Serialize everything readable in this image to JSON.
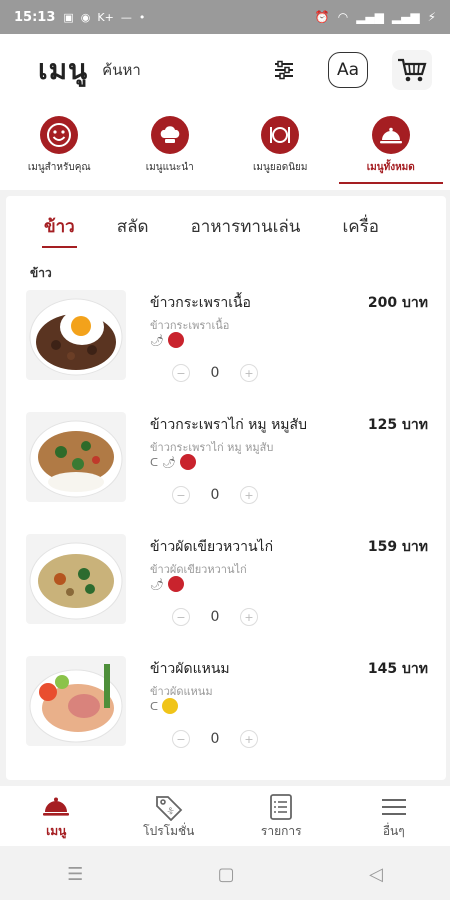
{
  "status": {
    "time": "15:13",
    "icons_left": [
      "LINE",
      "msg",
      "K+",
      "—",
      "•"
    ],
    "icons_right": [
      "alarm",
      "wifi",
      "signal",
      "signal",
      "charging"
    ]
  },
  "header": {
    "title": "เมนู",
    "search_label": "ค้นหา",
    "font_button": "Aa"
  },
  "categories": [
    {
      "label": "เมนูสำหรับคุณ",
      "icon": "smile-icon"
    },
    {
      "label": "เมนูแนะนำ",
      "icon": "chef-hat-icon"
    },
    {
      "label": "เมนูยอดนิยม",
      "icon": "plate-icon"
    },
    {
      "label": "เมนูทั้งหมด",
      "icon": "cloche-icon",
      "active": true
    }
  ],
  "subtabs": [
    "ข้าว",
    "สลัด",
    "อาหารทานเล่น",
    "เครื่อ"
  ],
  "section_title": "ข้าว",
  "items": [
    {
      "name": "ข้าวกระเพราเนื้อ",
      "desc": "ข้าวกระเพราเนื้อ",
      "price": "200 บาท",
      "qty": "0",
      "tags": [
        "🌶"
      ],
      "dots": [
        "#c9232d"
      ]
    },
    {
      "name": "ข้าวกระเพราไก่ หมู หมูสับ",
      "desc": "ข้าวกระเพราไก่ หมู หมูสับ",
      "price": "125 บาท",
      "qty": "0",
      "tags": [
        "ᑕ",
        "🌶"
      ],
      "dots": [
        "#c9232d"
      ]
    },
    {
      "name": "ข้าวผัดเขียวหวานไก่",
      "desc": "ข้าวผัดเขียวหวานไก่",
      "price": "159 บาท",
      "qty": "0",
      "tags": [
        "🌶"
      ],
      "dots": [
        "#c9232d"
      ]
    },
    {
      "name": "ข้าวผัดแหนม",
      "desc": "ข้าวผัดแหนม",
      "price": "145 บาท",
      "qty": "0",
      "tags": [
        "ᑕ"
      ],
      "dots": [
        "#f0c419"
      ]
    }
  ],
  "bottom_nav": [
    {
      "label": "เมนู",
      "icon": "cloche-icon",
      "active": true
    },
    {
      "label": "โปรโมชั่น",
      "icon": "tag-icon"
    },
    {
      "label": "รายการ",
      "icon": "list-icon"
    },
    {
      "label": "อื่นๆ",
      "icon": "hamburger-icon"
    }
  ],
  "colors": {
    "accent": "#a51e22",
    "chili": "#c9232d",
    "mild": "#f0c419"
  }
}
